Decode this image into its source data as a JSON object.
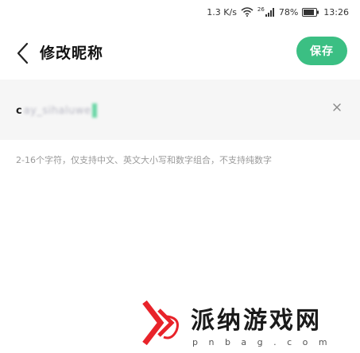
{
  "status_bar": {
    "speed": "1.3 K/s",
    "network_tag": "26",
    "battery_percent": "78%",
    "time": "13:26"
  },
  "header": {
    "title": "修改昵称",
    "save_label": "保存"
  },
  "input": {
    "first_char": "c",
    "blurred_value": "ay_sihaluwe"
  },
  "hint": "2-16个字符，仅支持中文、英文大小写和数字组合，不支持纯数字",
  "watermark": {
    "title": "派纳游戏网",
    "url": "p n b a g . c o m"
  },
  "colors": {
    "accent": "#3bbf83",
    "watermark_red": "#e8232a"
  }
}
